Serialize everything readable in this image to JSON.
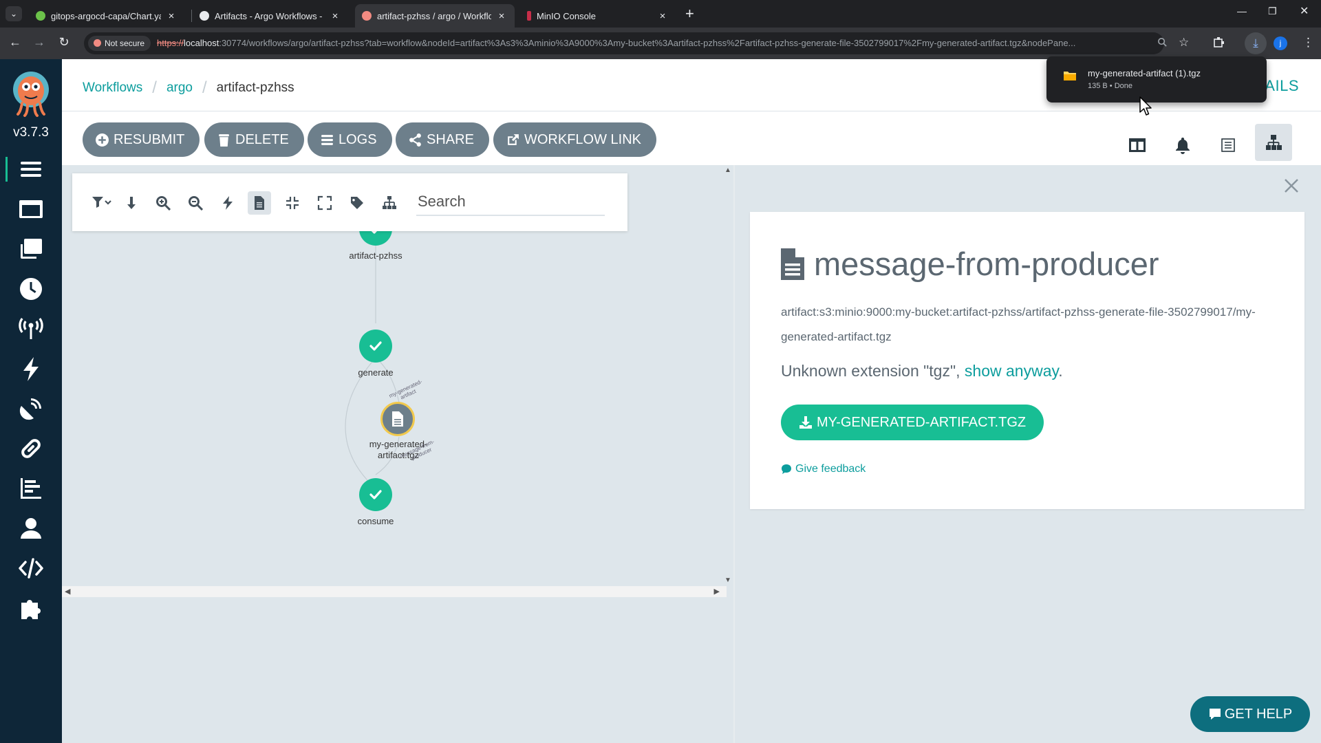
{
  "browser": {
    "tabs": [
      {
        "title": "gitops-argocd-capa/Chart.yaml",
        "favicon_color": "#6cc24a",
        "active": false
      },
      {
        "title": "Artifacts - Argo Workflows - The",
        "favicon_color": "#e8eaed",
        "active": false
      },
      {
        "title": "artifact-pzhss / argo / Workflow",
        "favicon_color": "#f28b82",
        "active": true
      },
      {
        "title": "MinIO Console",
        "favicon_color": "#c72e49",
        "active": false
      }
    ],
    "security_label": "Not secure",
    "url_scheme": "https://",
    "url_host": "localhost",
    "url_rest": ":30774/workflows/argo/artifact-pzhss?tab=workflow&nodeId=artifact%3As3%3Aminio%3A9000%3Amy-bucket%3Aartifact-pzhss%2Fartifact-pzhss-generate-file-3502799017%2Fmy-generated-artifact.tgz&nodePane...",
    "profile_initial": "j",
    "download": {
      "filename": "my-generated-artifact (1).tgz",
      "status": "135 B • Done"
    }
  },
  "app": {
    "version": "v3.7.3",
    "nav_items": [
      "workflows",
      "workflow-templates",
      "cluster-workflow-templates",
      "cron-workflows",
      "event-sources",
      "sensors",
      "event-flow",
      "api-docs-link",
      "reports",
      "user-info",
      "api-docs",
      "plugins"
    ]
  },
  "breadcrumb": {
    "root": "Workflows",
    "namespace": "argo",
    "current": "artifact-pzhss"
  },
  "details_link": "AILS",
  "actions": {
    "resubmit": "RESUBMIT",
    "delete": "DELETE",
    "logs": "LOGS",
    "share": "SHARE",
    "workflow_link": "WORKFLOW LINK"
  },
  "graph": {
    "search_placeholder": "Search",
    "nodes": {
      "root": "artifact-pzhss",
      "generate": "generate",
      "artifact_line1": "my-generated-",
      "artifact_line2": "artifact.tgz",
      "consume": "consume"
    },
    "edge_labels": {
      "out_line1": "my-generated-",
      "out_line2": "artifact",
      "in_line1": "message-from-",
      "in_line2": "producer"
    }
  },
  "artifact_panel": {
    "title": "message-from-producer",
    "key": "artifact:s3:minio:9000:my-bucket:artifact-pzhss/artifact-pzhss-generate-file-3502799017/my-generated-artifact.tgz",
    "message_prefix": "Unknown extension \"tgz\", ",
    "show_anyway": "show anyway",
    "message_suffix": ".",
    "download_button": "MY-GENERATED-ARTIFACT.TGZ",
    "feedback": "Give feedback"
  },
  "get_help": "GET HELP",
  "colors": {
    "sidebar": "#0e2638",
    "success": "#18be94",
    "accent": "#0c9d9d",
    "button": "#6d7f8b"
  }
}
